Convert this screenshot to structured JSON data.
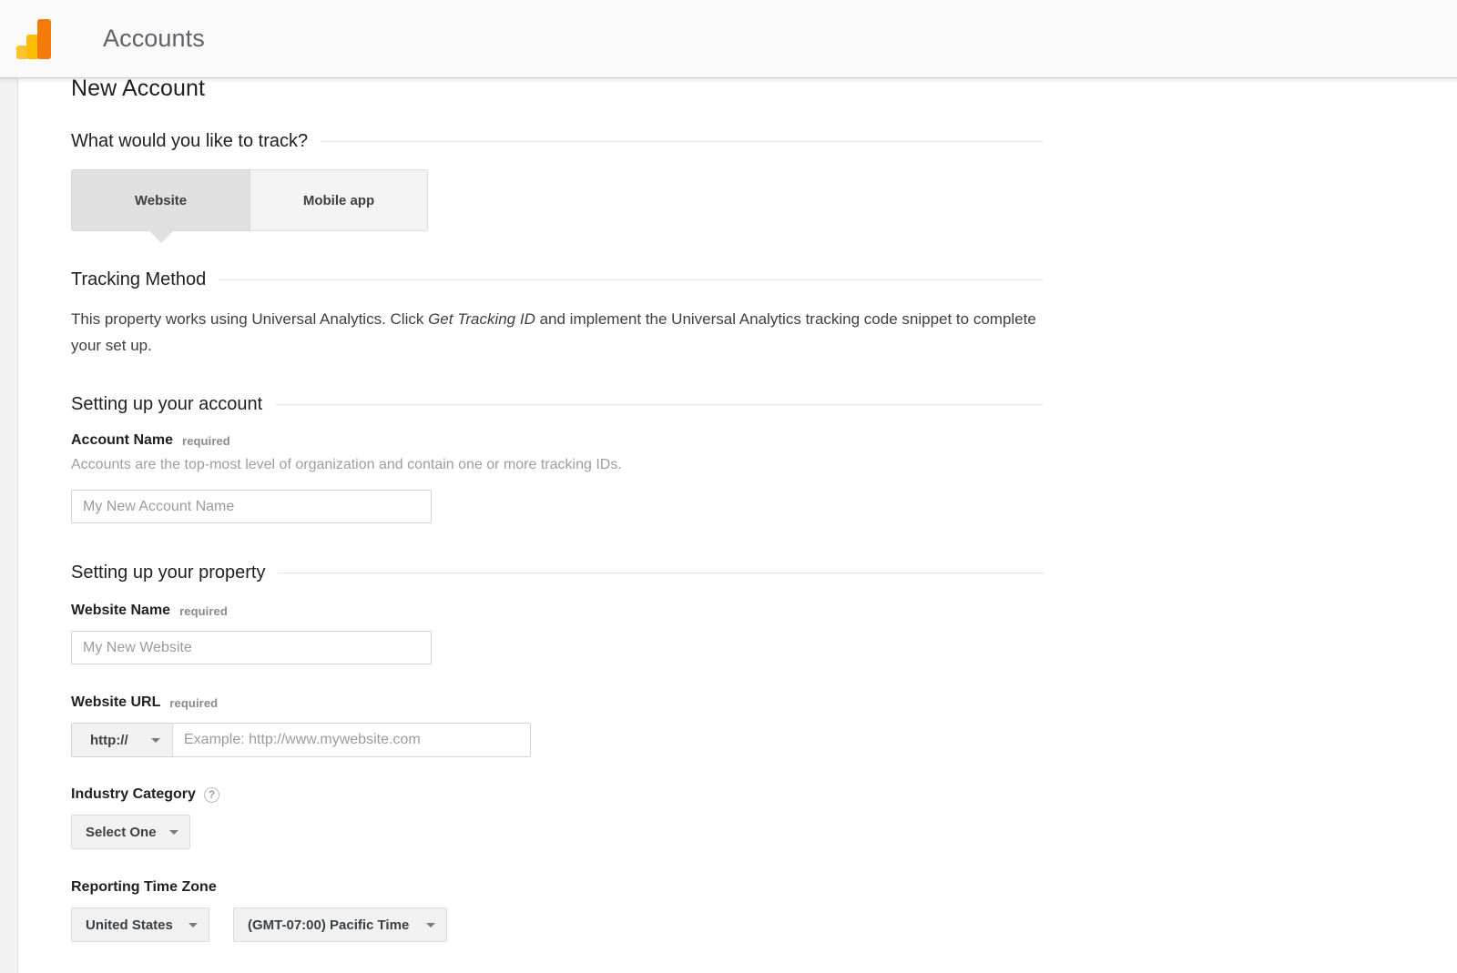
{
  "appbar": {
    "logo_name": "google-analytics-logo",
    "title": "Accounts"
  },
  "page": {
    "title": "New Account"
  },
  "track_section": {
    "heading": "What would you like to track?",
    "tabs": [
      {
        "label": "Website",
        "selected": true
      },
      {
        "label": "Mobile app",
        "selected": false
      }
    ]
  },
  "tracking_method": {
    "heading": "Tracking Method",
    "paragraph_before": "This property works using Universal Analytics. Click ",
    "paragraph_emphasis": "Get Tracking ID",
    "paragraph_after": " and implement the Universal Analytics tracking code snippet to complete your set up."
  },
  "account_section": {
    "heading": "Setting up your account",
    "account_name": {
      "label": "Account Name",
      "required_text": "required",
      "hint": "Accounts are the top-most level of organization and contain one or more tracking IDs.",
      "value": "",
      "placeholder": "My New Account Name"
    }
  },
  "property_section": {
    "heading": "Setting up your property",
    "website_name": {
      "label": "Website Name",
      "required_text": "required",
      "value": "",
      "placeholder": "My New Website"
    },
    "website_url": {
      "label": "Website URL",
      "required_text": "required",
      "scheme_value": "http://",
      "value": "",
      "placeholder": "Example: http://www.mywebsite.com"
    },
    "industry_category": {
      "label": "Industry Category",
      "help_glyph": "?",
      "selected": "Select One"
    },
    "reporting_time_zone": {
      "label": "Reporting Time Zone",
      "country_selected": "United States",
      "zone_selected": "(GMT-07:00) Pacific Time"
    }
  },
  "colors": {
    "logo_light": "#f9c22e",
    "logo_mid": "#fbbc04",
    "logo_dark": "#f47b0a",
    "appbar_bg": "#fafafa",
    "tab_active_bg": "#e0e0e0",
    "tab_inactive_bg": "#f3f3f3",
    "control_bg": "#f1f1f1"
  }
}
